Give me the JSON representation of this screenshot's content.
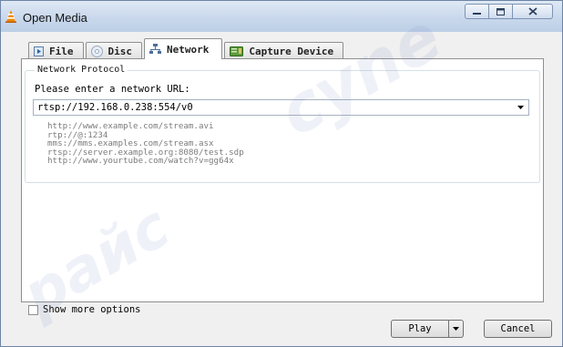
{
  "window": {
    "title": "Open Media"
  },
  "tabs": [
    {
      "label": "File",
      "icon": "file-icon"
    },
    {
      "label": "Disc",
      "icon": "disc-icon"
    },
    {
      "label": "Network",
      "icon": "network-icon"
    },
    {
      "label": "Capture Device",
      "icon": "capture-device-icon"
    }
  ],
  "network": {
    "group_title": "Network Protocol",
    "prompt": "Please enter a network URL:",
    "url_value": "rtsp://192.168.0.238:554/v0",
    "examples": [
      "http://www.example.com/stream.avi",
      "rtp://@:1234",
      "mms://mms.examples.com/stream.asx",
      "rtsp://server.example.org:8080/test.sdp",
      "http://www.yourtube.com/watch?v=gg64x"
    ]
  },
  "options": {
    "show_more_label": "Show more options"
  },
  "buttons": {
    "play": "Play",
    "cancel": "Cancel"
  },
  "watermarks": [
    "cyne",
    "paйc"
  ],
  "colors": {
    "titlebar": "#c9d8ec",
    "panel": "#ffffff",
    "window_bg": "#f0f0f0"
  }
}
